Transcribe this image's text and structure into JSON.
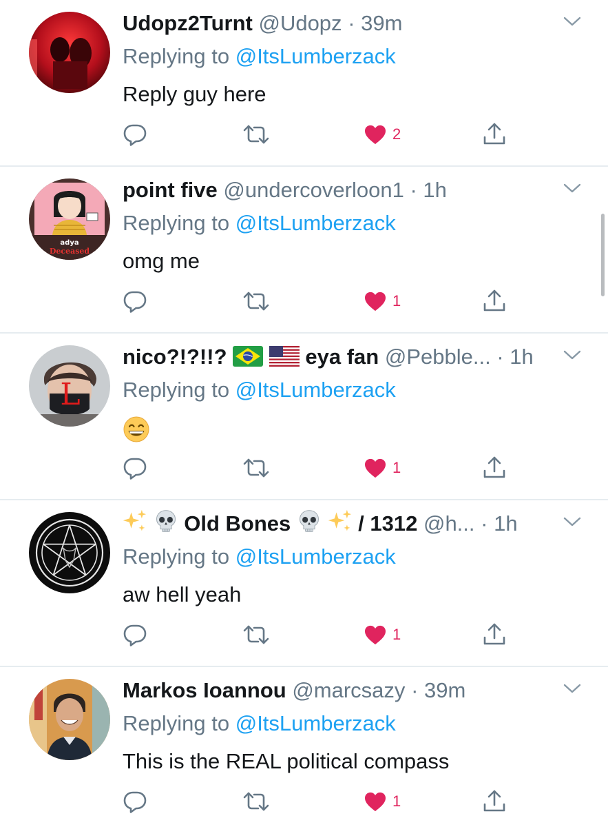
{
  "colors": {
    "accent": "#1da1f2",
    "like": "#e0245e",
    "muted": "#657786",
    "text": "#14171a",
    "divider": "#e6ecf0"
  },
  "tweets": [
    {
      "display_name": "Udopz2Turnt",
      "handle": "@Udopz",
      "dot": "·",
      "time": "39m",
      "replying_prefix": "Replying to",
      "replying_to": "@ItsLumberzack",
      "text": "Reply guy here",
      "likes": "2",
      "avatar": "red-photo-avatar"
    },
    {
      "display_name": "point five",
      "handle": "@undercoverloon1",
      "dot": "·",
      "time": "1h",
      "replying_prefix": "Replying to",
      "replying_to": "@ItsLumberzack",
      "text": "omg me",
      "likes": "1",
      "avatar": "cartoon-avatar",
      "avatar_text_1": "adya",
      "avatar_text_2": "Deceased"
    },
    {
      "display_name": "nico?!?!!?",
      "name_flags": [
        "brazil-flag-icon",
        "usa-flag-icon"
      ],
      "display_name_suffix": "eya fan",
      "handle": "@Pebble...",
      "dot": "·",
      "time": "1h",
      "replying_prefix": "Replying to",
      "replying_to": "@ItsLumberzack",
      "text_emoji": "grinning-face-emoji",
      "likes": "1",
      "avatar": "masked-person-avatar",
      "avatar_text_1": "L"
    },
    {
      "display_name_prefix_icons": [
        "sparkles-icon",
        "skull-icon"
      ],
      "display_name": "Old Bones",
      "display_name_suffix_icons": [
        "skull-icon",
        "sparkles-icon"
      ],
      "display_name_suffix": "/ 1312",
      "handle": "@h...",
      "dot": "·",
      "time": "1h",
      "replying_prefix": "Replying to",
      "replying_to": "@ItsLumberzack",
      "text": "aw hell yeah",
      "likes": "1",
      "avatar": "pentagram-avatar"
    },
    {
      "display_name": "Markos Ioannou",
      "handle": "@marcsazy",
      "dot": "·",
      "time": "39m",
      "replying_prefix": "Replying to",
      "replying_to": "@ItsLumberzack",
      "text": "This is the REAL political compass",
      "likes": "1",
      "avatar": "smiling-man-avatar"
    }
  ]
}
